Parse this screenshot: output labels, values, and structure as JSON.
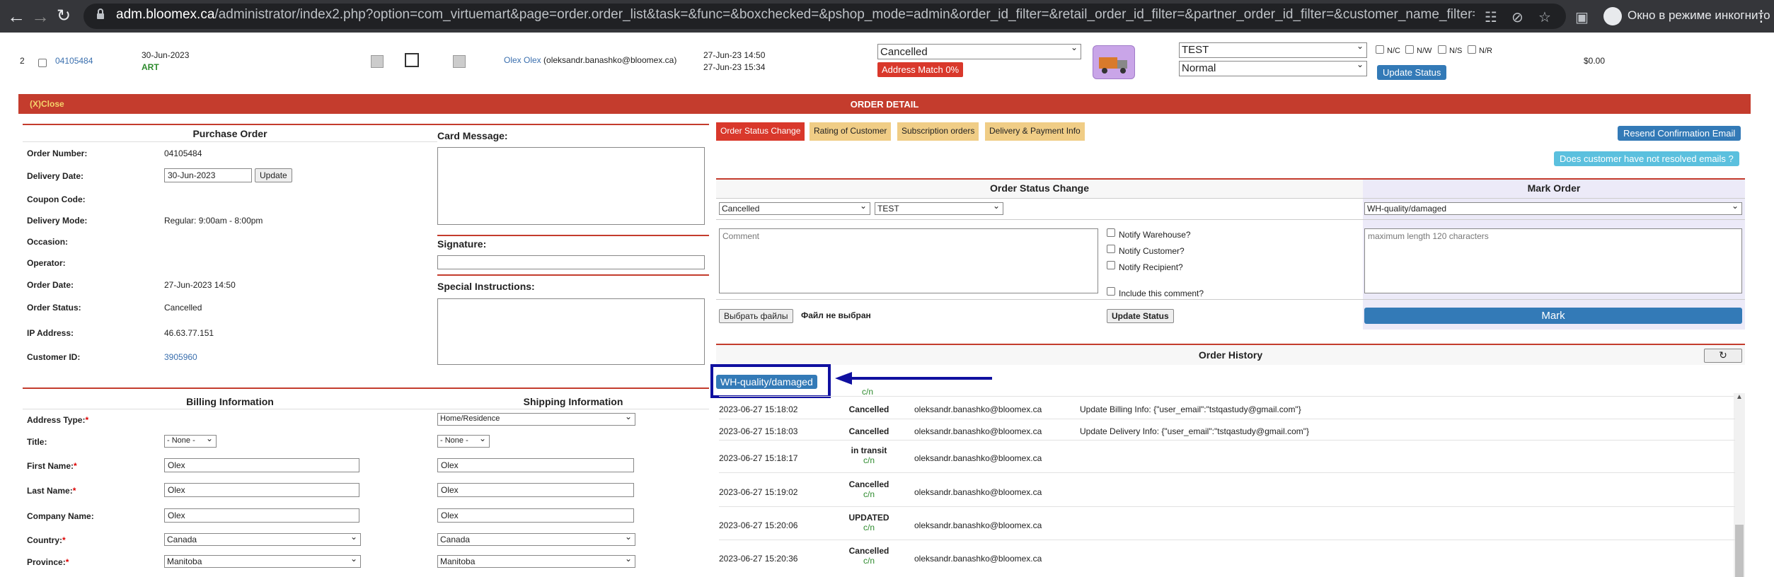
{
  "browser": {
    "url_host": "adm.bloomex.ca",
    "url_path": "/administrator/index2.php?option=com_virtuemart&page=order.order_list&task=&func=&boxchecked=&pshop_mode=admin&order_id_filter=&retail_order_id_filter=&partner_order_id_filter=&customer_name_filter=&user_email...",
    "incognito_label": "Окно в режиме инкогнито"
  },
  "order_row": {
    "row_num": "2",
    "order_id": "04105484",
    "date": "30-Jun-2023",
    "code": "ART",
    "customer_name": "Olex Olex",
    "customer_email": "(oleksandr.banashko@bloomex.ca)",
    "created": "27-Jun-23 14:50",
    "modified": "27-Jun-23 15:34",
    "status_select": "Cancelled",
    "address_match": "Address Match 0%",
    "warehouse_select": "TEST",
    "priority_select": "Normal",
    "flags": [
      "N/C",
      "N/W",
      "N/S",
      "N/R"
    ],
    "update_status": "Update Status",
    "total": "$0.00"
  },
  "detail_bar": {
    "close": "(X)Close",
    "title": "ORDER DETAIL"
  },
  "purchase_order": {
    "title": "Purchase Order",
    "rows": [
      {
        "label": "Order Number:",
        "value": "04105484"
      },
      {
        "label": "Delivery Date:",
        "value": "30-Jun-2023"
      },
      {
        "label": "Coupon Code:",
        "value": ""
      },
      {
        "label": "Delivery Mode:",
        "value": "Regular: 9:00am - 8:00pm"
      },
      {
        "label": "Occasion:",
        "value": ""
      },
      {
        "label": "Operator:",
        "value": ""
      },
      {
        "label": "Order Date:",
        "value": "27-Jun-2023 14:50"
      },
      {
        "label": "Order Status:",
        "value": "Cancelled"
      },
      {
        "label": "IP Address:",
        "value": "46.63.77.151"
      },
      {
        "label": "Customer ID:",
        "value": "3905960"
      }
    ],
    "update_btn": "Update"
  },
  "card": {
    "card_message": "Card Message:",
    "signature": "Signature:",
    "special_instructions": "Special Instructions:"
  },
  "tabs": [
    "Order Status Change",
    "Rating of Customer",
    "Subscription orders",
    "Delivery & Payment Info"
  ],
  "right_buttons": {
    "resend": "Resend Confirmation Email",
    "unresolved": "Does customer have not resolved emails ?"
  },
  "status_change": {
    "title": "Order Status Change",
    "status": "Cancelled",
    "warehouse": "TEST",
    "comment_placeholder": "Comment",
    "notify": [
      "Notify Warehouse?",
      "Notify Customer?",
      "Notify Recipient?"
    ],
    "include_comment": "Include this comment?",
    "file_btn": "Выбрать файлы",
    "file_none": "Файл не выбран",
    "update_btn": "Update Status"
  },
  "mark_order": {
    "title": "Mark Order",
    "select": "WH-quality/damaged",
    "placeholder": "maximum length 120 characters",
    "mark_btn": "Mark"
  },
  "history": {
    "title": "Order History",
    "tag": "WH-quality/damaged",
    "partial_sub": "c/n",
    "rows": [
      {
        "time": "2023-06-27 15:18:02",
        "status": "Cancelled",
        "sub": "",
        "user": "oleksandr.banashko@bloomex.ca",
        "note": "Update Billing Info: {\"user_email\":\"tstqastudy@gmail.com\"}"
      },
      {
        "time": "2023-06-27 15:18:03",
        "status": "Cancelled",
        "sub": "",
        "user": "oleksandr.banashko@bloomex.ca",
        "note": "Update Delivery Info: {\"user_email\":\"tstqastudy@gmail.com\"}"
      },
      {
        "time": "2023-06-27 15:18:17",
        "status": "in transit",
        "sub": "c/n",
        "user": "oleksandr.banashko@bloomex.ca",
        "note": ""
      },
      {
        "time": "2023-06-27 15:19:02",
        "status": "Cancelled",
        "sub": "c/n",
        "user": "oleksandr.banashko@bloomex.ca",
        "note": ""
      },
      {
        "time": "2023-06-27 15:20:06",
        "status": "UPDATED",
        "sub": "c/n",
        "user": "oleksandr.banashko@bloomex.ca",
        "note": ""
      },
      {
        "time": "2023-06-27 15:20:36",
        "status": "Cancelled",
        "sub": "c/n",
        "user": "oleksandr.banashko@bloomex.ca",
        "note": ""
      }
    ]
  },
  "billing": {
    "title_billing": "Billing Information",
    "title_shipping": "Shipping Information",
    "rows": [
      {
        "label": "Address Type:",
        "req": "*",
        "billing": "",
        "shipping": "Home/Residence"
      },
      {
        "label": "Title:",
        "req": "",
        "billing": "- None -",
        "shipping": "- None -"
      },
      {
        "label": "First Name:",
        "req": "*",
        "billing": "Olex",
        "shipping": "Olex"
      },
      {
        "label": "Last Name:",
        "req": "*",
        "billing": "Olex",
        "shipping": "Olex"
      },
      {
        "label": "Company Name:",
        "req": "",
        "billing": "Olex",
        "shipping": "Olex"
      },
      {
        "label": "Country:",
        "req": "*",
        "billing": "Canada",
        "shipping": "Canada"
      },
      {
        "label": "Province:",
        "req": "*",
        "billing": "Manitoba",
        "shipping": "Manitoba"
      }
    ]
  },
  "colors": {
    "accent_red": "#c43c2d",
    "tab_active": "#d9382b",
    "tab_inactive": "#f0cd86",
    "primary_blue": "#337ab7",
    "highlight_border": "#1010a0",
    "cyan_button": "#5bc0de"
  }
}
